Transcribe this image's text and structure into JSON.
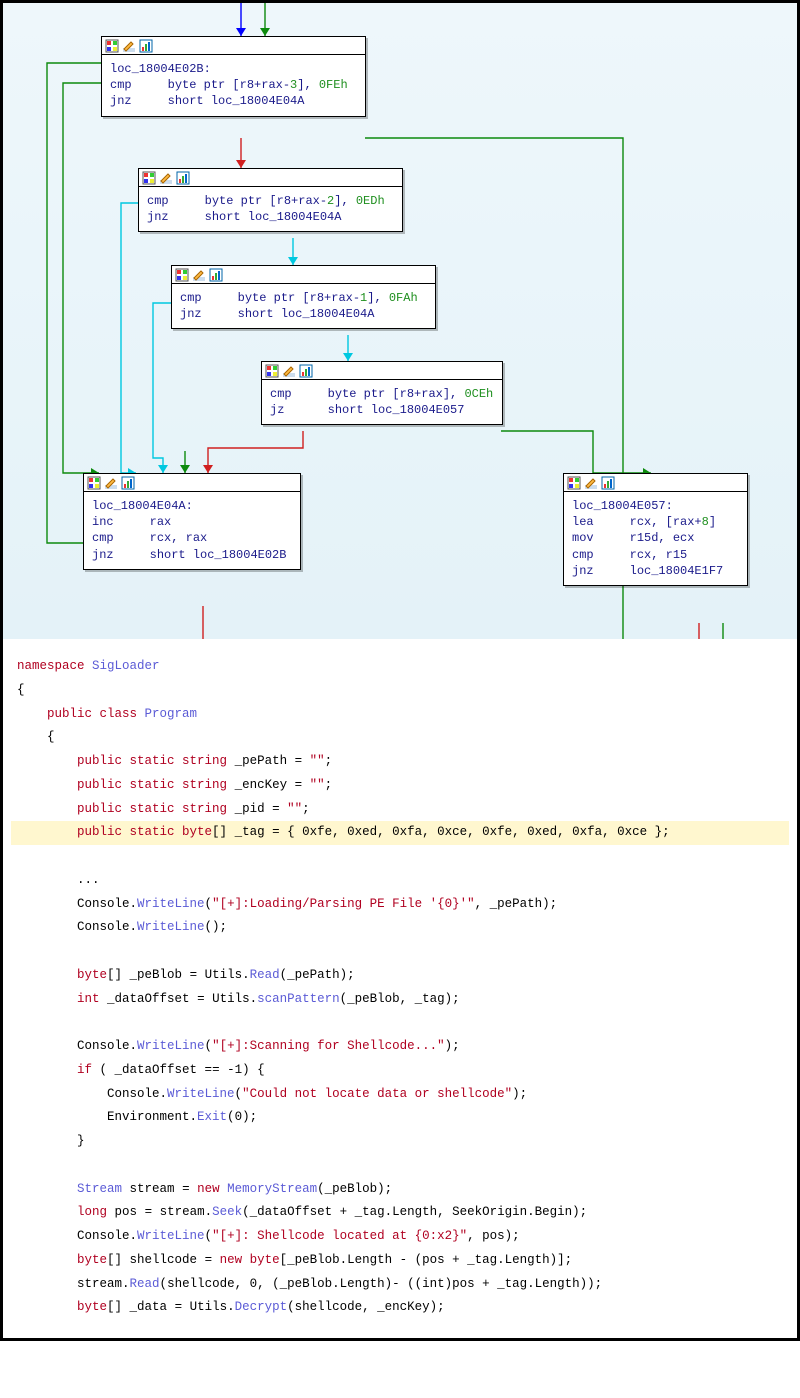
{
  "ida": {
    "nodes": {
      "n1": {
        "label": "loc_18004E02B:",
        "l1_m": "cmp",
        "l1_op": "byte ptr [r8+rax-",
        "l1_off": "3",
        "l1_rest": "], ",
        "l1_val": "0FEh",
        "l2_m": "jnz",
        "l2_op": "short loc_18004E04A"
      },
      "n2": {
        "l1_m": "cmp",
        "l1_op": "byte ptr [r8+rax-",
        "l1_off": "2",
        "l1_rest": "], ",
        "l1_val": "0EDh",
        "l2_m": "jnz",
        "l2_op": "short loc_18004E04A"
      },
      "n3": {
        "l1_m": "cmp",
        "l1_op": "byte ptr [r8+rax-",
        "l1_off": "1",
        "l1_rest": "], ",
        "l1_val": "0FAh",
        "l2_m": "jnz",
        "l2_op": "short loc_18004E04A"
      },
      "n4": {
        "l1_m": "cmp",
        "l1_op": "byte ptr [r8+rax], ",
        "l1_val": "0CEh",
        "l2_m": "jz",
        "l2_op": "short loc_18004E057"
      },
      "n5": {
        "label": "loc_18004E04A:",
        "l1_m": "inc",
        "l1_op": "rax",
        "l2_m": "cmp",
        "l2_op": "rcx, rax",
        "l3_m": "jnz",
        "l3_op": "short loc_18004E02B"
      },
      "n6": {
        "label": "loc_18004E057:",
        "l1_m": "lea",
        "l1_op": "rcx, [rax+",
        "l1_off": "8",
        "l1_rest": "]",
        "l2_m": "mov",
        "l2_op": "r15d, ecx",
        "l3_m": "cmp",
        "l3_op": "rcx, r15",
        "l4_m": "jnz",
        "l4_op": "loc_18004E1F7"
      }
    }
  },
  "csharp": {
    "ns": "SigLoader",
    "cls": "Program",
    "f1": "_pePath",
    "f1v": "\"\"",
    "f2": "_encKey",
    "f2v": "\"\"",
    "f3": "_pid",
    "f3v": "\"\"",
    "f4": "_tag",
    "tag_vals": "{ 0xfe, 0xed, 0xfa, 0xce, 0xfe, 0xed, 0xfa, 0xce }",
    "ell": "...",
    "cw1": "\"[+]:Loading/Parsing PE File '{0}'\"",
    "cw1a": ", _pePath",
    "blob": "_peBlob",
    "readfn": "Read",
    "readarg": "_pePath",
    "doff": "_dataOffset",
    "scan": "scanPattern",
    "scanargs": "_peBlob, _tag",
    "cw2": "\"[+]:Scanning for Shellcode...\"",
    "ifcond": "_dataOffset == -1",
    "cw3": "\"Could not locate data or shellcode\"",
    "exitarg": "0",
    "stream": "stream",
    "memstream": "MemoryStream",
    "memarg": "_peBlob",
    "pos": "pos",
    "seek": "Seek",
    "seekargs": "_dataOffset + _tag.Length, SeekOrigin.Begin",
    "cw4": "\"[+]: Shellcode located at {0:x2}\"",
    "cw4a": "pos",
    "shell": "shellcode",
    "shargs": "_peBlob.Length - (pos + _tag.Length)",
    "readargs": "shellcode, 0, (_peBlob.Length)- ((int)pos + _tag.Length)",
    "data": "_data",
    "decrypt": "Decrypt",
    "decargs": "shellcode, _encKey"
  }
}
